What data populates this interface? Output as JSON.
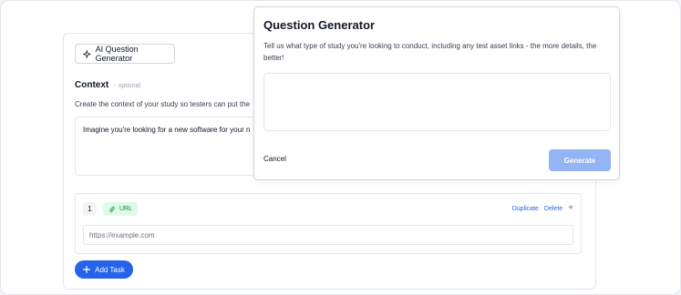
{
  "background_card": {
    "ai_button_label": "AI Question Generator",
    "context": {
      "title": "Context",
      "optional_label": "- optional",
      "description": "Create the context of your study so testers can put the",
      "value": "Imagine you're looking for a new software for your n"
    },
    "task": {
      "number": "1",
      "type_label": "URL",
      "duplicate_label": "Duplicate",
      "delete_label": "Delete",
      "add_icon": "+",
      "url_placeholder": "https://example.com"
    },
    "add_task_label": "Add Task"
  },
  "modal": {
    "title": "Question Generator",
    "description": "Tell us what type of study you're looking to conduct, including any test asset links - the more details, the better!",
    "textarea_value": "",
    "cancel_label": "Cancel",
    "generate_label": "Generate"
  },
  "colors": {
    "primary": "#2563eb",
    "primary_disabled": "#93b4f5",
    "badge_bg": "#dcfce7",
    "badge_text": "#15803d"
  },
  "icons": {
    "ai_button": "sparkle-icon",
    "url_badge": "link-icon",
    "add_task": "plus-icon",
    "task_add": "plus-icon"
  }
}
